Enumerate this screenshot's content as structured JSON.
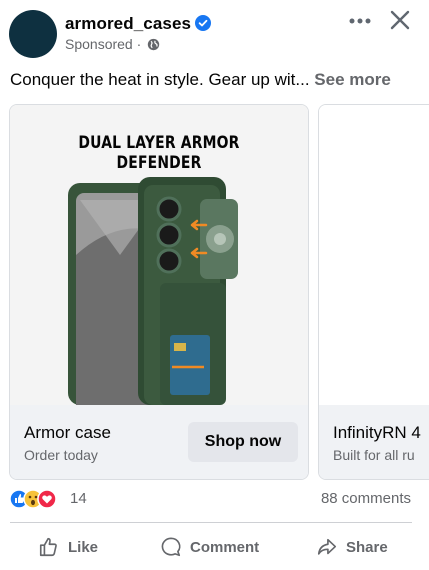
{
  "header": {
    "page_name": "armored_cases",
    "sponsored_label": "Sponsored ·"
  },
  "post": {
    "caption": "Conquer the heat in style. Gear up wit...",
    "see_more": "See more"
  },
  "carousel": {
    "cards": [
      {
        "image_headline": "DUAL LAYER ARMOR DEFENDER",
        "title": "Armor case",
        "subtitle": "Order today",
        "cta_label": "Shop now"
      },
      {
        "title": "InfinityRN 4",
        "subtitle": "Built for all ru"
      }
    ]
  },
  "engagement": {
    "reaction_count": "14",
    "comments_label": "88 comments"
  },
  "actions": {
    "like_label": "Like",
    "comment_label": "Comment",
    "share_label": "Share"
  },
  "colors": {
    "accent": "#1877f2",
    "avatar": "#0e3040",
    "phone_green": "#3c5a3f"
  }
}
